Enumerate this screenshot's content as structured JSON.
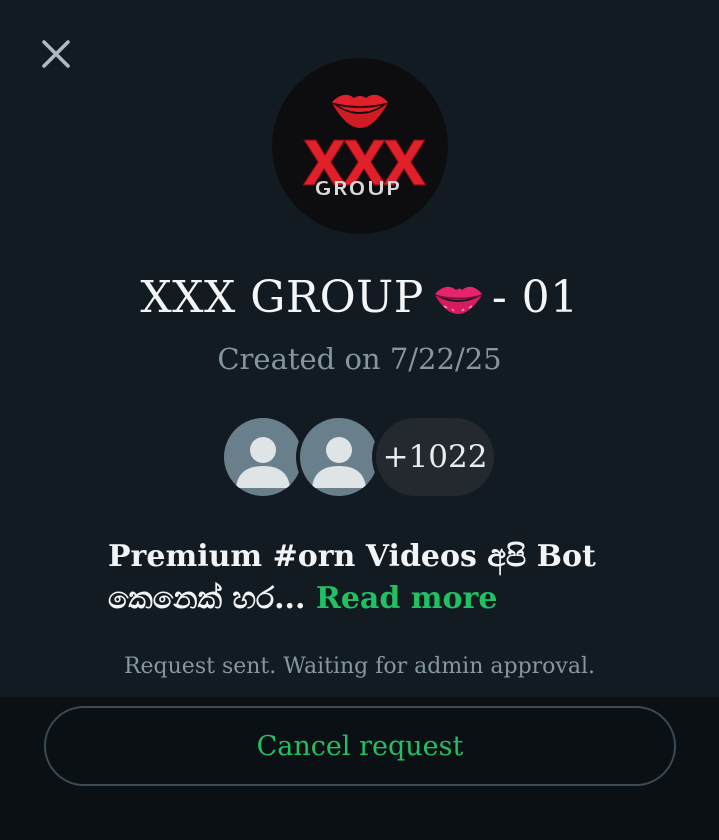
{
  "header": {
    "close_icon": "close-icon"
  },
  "group": {
    "avatar_icon": "xxx-group-logo",
    "title": "XXX GROUP",
    "title_emoji": "kiss-mark-icon",
    "title_suffix": "- 01",
    "created": "Created on 7/22/25"
  },
  "members": {
    "avatars": [
      "default-avatar-icon",
      "default-avatar-icon"
    ],
    "more_count": "+1022"
  },
  "description": {
    "text": "Premium #orn Videos අපි Bot කෙනෙක් හර...",
    "read_more": "Read more"
  },
  "status": {
    "text": "Request sent. Waiting for admin approval."
  },
  "actions": {
    "cancel_label": "Cancel request"
  },
  "colors": {
    "background": "#121b22",
    "accent": "#21c063",
    "muted": "#8696a0"
  }
}
